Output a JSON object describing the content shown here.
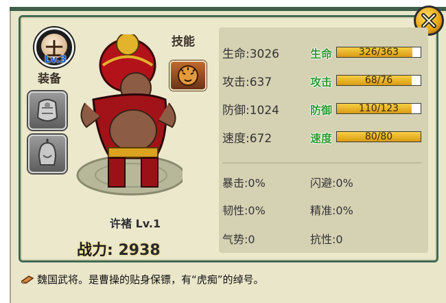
{
  "avatar": {
    "char": "士",
    "level": "Lv.3"
  },
  "equipment": {
    "label": "装备"
  },
  "skill": {
    "label": "技能"
  },
  "hero": {
    "name": "许褚 Lv.1",
    "power_label": "战力:",
    "power_value": "2938"
  },
  "stats": [
    {
      "label": "生命",
      "value": "3026",
      "bar_label": "生命",
      "bar_text": "326/363",
      "fill": 0.898
    },
    {
      "label": "攻击",
      "value": "637",
      "bar_label": "攻击",
      "bar_text": "68/76",
      "fill": 0.895
    },
    {
      "label": "防御",
      "value": "1024",
      "bar_label": "防御",
      "bar_text": "110/123",
      "fill": 0.894
    },
    {
      "label": "速度",
      "value": "672",
      "bar_label": "速度",
      "bar_text": "80/80",
      "fill": 1.0
    }
  ],
  "sub_stats": [
    {
      "label": "暴击",
      "value": "0%"
    },
    {
      "label": "闪避",
      "value": "0%"
    },
    {
      "label": "韧性",
      "value": "0%"
    },
    {
      "label": "精准",
      "value": "0%"
    },
    {
      "label": "气势",
      "value": "0"
    },
    {
      "label": "抗性",
      "value": "0"
    }
  ],
  "description": "魏国武将。是曹操的贴身保镖，有“虎痴”的绰号。",
  "icons": {
    "close": "close-x-icon",
    "desc": "scroll-icon"
  },
  "colors": {
    "frame": "#3f6a53",
    "panel": "#ebe8cc",
    "stats_bg": "#d5d1b3",
    "bar_fill": "#e8b52a",
    "bar_label": "#2e9a2e"
  }
}
